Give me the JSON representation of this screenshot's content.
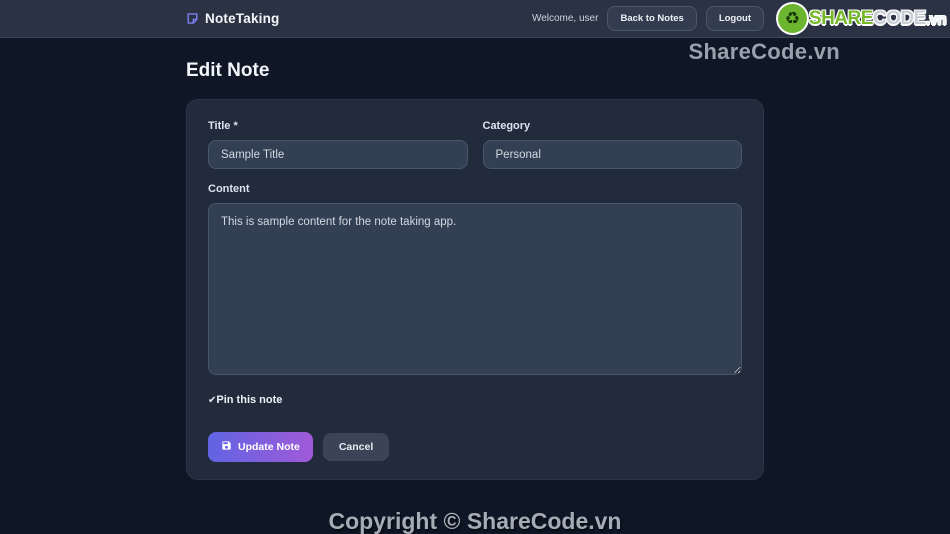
{
  "navbar": {
    "brand": "NoteTaking",
    "welcome": "Welcome, user",
    "back_button": "Back to Notes",
    "logout_button": "Logout"
  },
  "logo": {
    "share": "SHARE",
    "code": "CODE",
    "vn": ".vn",
    "icon": "recycle-icon",
    "green": "#76b82a"
  },
  "watermark": "ShareCode.vn",
  "page": {
    "title": "Edit Note"
  },
  "form": {
    "title_label": "Title *",
    "title_value": "Sample Title",
    "category_label": "Category",
    "category_value": "Personal",
    "content_label": "Content",
    "content_value": "This is sample content for the note taking app.",
    "pin_check": "✔",
    "pin_label": "Pin this note",
    "update_button": "Update Note",
    "cancel_button": "Cancel"
  },
  "footer": {
    "copyright": "Copyright © ShareCode.vn"
  },
  "colors": {
    "accent_gradient_start": "#6064e3",
    "accent_gradient_end": "#a05ad8",
    "navbar_bg": "#2a3243",
    "page_bg": "#0f1726",
    "card_bg": "#212b3c",
    "input_bg": "#333f53"
  }
}
